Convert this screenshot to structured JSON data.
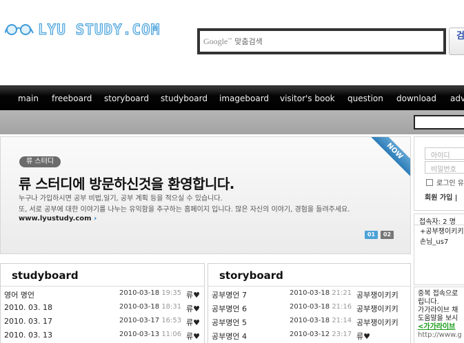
{
  "header": {
    "logo_text": "LYU STUDY.COM",
    "search": {
      "provider_mark": "Google",
      "provider_tm": "™",
      "placeholder": "맞춤검색",
      "button_label": "검"
    }
  },
  "nav": {
    "items": [
      "main",
      "freeboard",
      "storyboard",
      "studyboard",
      "imageboard",
      "visitor's book",
      "question",
      "download",
      "adv"
    ]
  },
  "banner": {
    "badge": "류 스터디",
    "title": "류 스터디에 방문하신것을 환영합니다.",
    "lines": [
      "누구나 가입하시면 공부 비법,일기, 공부 계획 등을 적으실 수 있습니다.",
      "또, 서로 공부에 대한 이야기를 나누는 유익함을 추구하는 홈페이지 입니다. 많은 자신의 이야기, 경험을 들려주세요."
    ],
    "link": "www.lyustudy.com",
    "link_arrow": "›",
    "ribbon": "NOW",
    "pages": [
      "01",
      "02"
    ],
    "active_page": "01"
  },
  "login": {
    "id_placeholder": "아이디",
    "pw_placeholder": "비밀번호",
    "remember_label": "로그인 유",
    "join_label": "회원 가입 |"
  },
  "online": {
    "header": "접속자: 2 명",
    "users": [
      "+공부쟁이키키",
      "손님_us7"
    ]
  },
  "notice": {
    "lines": [
      "중복 접속으로",
      "립니다.",
      "가가라이브 채",
      "도움말을 보시"
    ],
    "link": "<가가라이브",
    "url": "http://www.g"
  },
  "studyboard": {
    "title": "studyboard",
    "rows": [
      {
        "title": "영어 명언",
        "date": "2010-03-18",
        "time": "19:35",
        "author": "류♥"
      },
      {
        "title": "2010. 03. 18",
        "date": "2010-03-18",
        "time": "18:31",
        "author": "류♥"
      },
      {
        "title": "2010. 03. 17",
        "date": "2010-03-17",
        "time": "16:53",
        "author": "류♥"
      },
      {
        "title": "2010. 03. 13",
        "date": "2010-03-13",
        "time": "11:06",
        "author": "류♥"
      }
    ]
  },
  "storyboard": {
    "title": "storyboard",
    "rows": [
      {
        "title": "공부명언 7",
        "date": "2010-03-18",
        "time": "21:21",
        "author": "공부쟁이키키"
      },
      {
        "title": "공부명언 6",
        "date": "2010-03-18",
        "time": "21:16",
        "author": "공부쟁이키키"
      },
      {
        "title": "공부명언 5",
        "date": "2010-03-18",
        "time": "21:14",
        "author": "공부쟁이키키"
      },
      {
        "title": "공부명언 4",
        "date": "2010-03-12",
        "time": "23:17",
        "author": "류♥"
      }
    ]
  },
  "colors": {
    "nav_bg": "#000000",
    "subbar_bg": "#aaaaaa",
    "logo_outline": "#3d9ad8",
    "ribbon": "#3a87c2",
    "page_active": "#4ba3d6",
    "page_inactive": "#777777",
    "notice_link": "#119911"
  }
}
